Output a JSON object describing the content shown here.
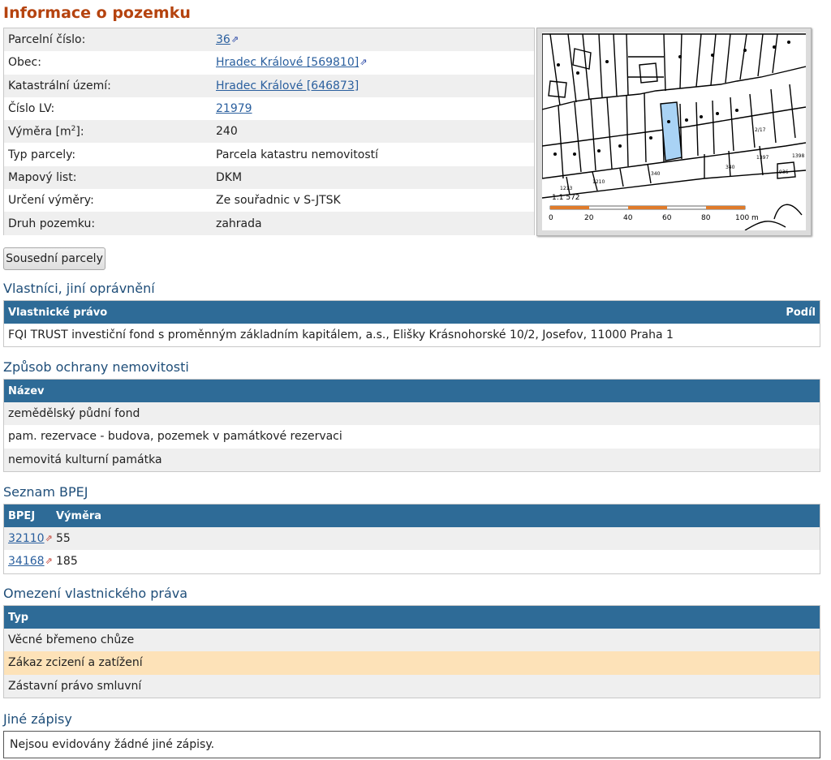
{
  "title": "Informace o pozemku",
  "info": [
    {
      "label": "Parcelní číslo:",
      "value": "36",
      "link": true,
      "ext": true
    },
    {
      "label": "Obec:",
      "value": "Hradec Králové [569810]",
      "link": true,
      "ext": true
    },
    {
      "label": "Katastrální území:",
      "value": "Hradec Králové [646873]",
      "link": true,
      "ext": false
    },
    {
      "label": "Číslo LV:",
      "value": "21979",
      "link": true,
      "ext": false
    },
    {
      "label_pre": "Výměra [m",
      "label_sup": "2",
      "label_post": "]:",
      "value": "240"
    },
    {
      "label": "Typ parcely:",
      "value": "Parcela katastru nemovitostí"
    },
    {
      "label": "Mapový list:",
      "value": "DKM"
    },
    {
      "label": "Určení výměry:",
      "value": "Ze souřadnic v S-JTSK"
    },
    {
      "label": "Druh pozemku:",
      "value": "zahrada"
    }
  ],
  "map": {
    "scale": "1:1 572",
    "ticks": [
      "0",
      "20",
      "40",
      "60",
      "80",
      "100 m"
    ],
    "parcel_labels": [
      "1210",
      "1213",
      "340",
      "2/17",
      "1397",
      "1398",
      "936",
      "340"
    ]
  },
  "neighbors_button": "Sousední parcely",
  "owners": {
    "heading": "Vlastníci, jiní oprávnění",
    "col_right": "Vlastnické právo",
    "col_share": "Podíl",
    "rows": [
      "FQI TRUST investiční fond s proměnným základním kapitálem, a.s., Elišky Krásnohorské 10/2, Josefov, 11000 Praha 1"
    ]
  },
  "protection": {
    "heading": "Způsob ochrany nemovitosti",
    "col": "Název",
    "rows": [
      "zemědělský půdní fond",
      "pam. rezervace - budova, pozemek v památkové rezervaci",
      "nemovitá kulturní památka"
    ]
  },
  "bpej": {
    "heading": "Seznam BPEJ",
    "col_code": "BPEJ",
    "col_area": "Výměra",
    "rows": [
      {
        "code": "32110",
        "area": "55"
      },
      {
        "code": "34168",
        "area": "185"
      }
    ]
  },
  "restrictions": {
    "heading": "Omezení vlastnického práva",
    "col": "Typ",
    "rows": [
      "Věcné břemeno chůze",
      "Zákaz zcizení a zatížení",
      "Zástavní právo smluvní"
    ],
    "highlight_color": "#fde2b8"
  },
  "other": {
    "heading": "Jiné zápisy",
    "text": "Nejsou evidovány žádné jiné zápisy."
  },
  "colors": {
    "title": "#b5430f",
    "heading": "#1f4e79",
    "table_header": "#2e6b97",
    "link": "#2a5f9e",
    "parcel_highlight": "#a9d3f5"
  }
}
